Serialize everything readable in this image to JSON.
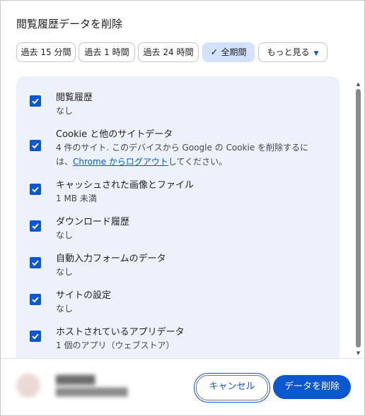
{
  "dialog": {
    "title": "閲覧履歴データを削除"
  },
  "time_ranges": [
    {
      "label": "過去 15 分間",
      "selected": false
    },
    {
      "label": "過去 1 時間",
      "selected": false
    },
    {
      "label": "過去 24 時間",
      "selected": false
    },
    {
      "label": "全期間",
      "selected": true
    }
  ],
  "more_chip": {
    "label": "もっと見る"
  },
  "items": [
    {
      "title": "閲覧履歴",
      "desc": "なし",
      "checked": true
    },
    {
      "title": "Cookie と他のサイトデータ",
      "desc_line1": "4 件のサイト. このデバイスから Google の Cookie を削除するに",
      "desc_prefix": "は、",
      "link": "Chrome からログアウト",
      "desc_suffix": "してください。",
      "checked": true
    },
    {
      "title": "キャッシュされた画像とファイル",
      "desc": "1 MB 未満",
      "checked": true
    },
    {
      "title": "ダウンロード履歴",
      "desc": "なし",
      "checked": true
    },
    {
      "title": "自動入力フォームのデータ",
      "desc": "なし",
      "checked": true
    },
    {
      "title": "サイトの設定",
      "desc": "なし",
      "checked": true
    },
    {
      "title": "ホストされているアプリデータ",
      "desc": "1 個のアプリ（ウェブストア）",
      "checked": true
    }
  ],
  "buttons": {
    "cancel": "キャンセル",
    "delete": "データを削除"
  },
  "colors": {
    "accent": "#0b57d0",
    "panel": "#edf2fa",
    "chip_selected": "#d3e3fd"
  }
}
